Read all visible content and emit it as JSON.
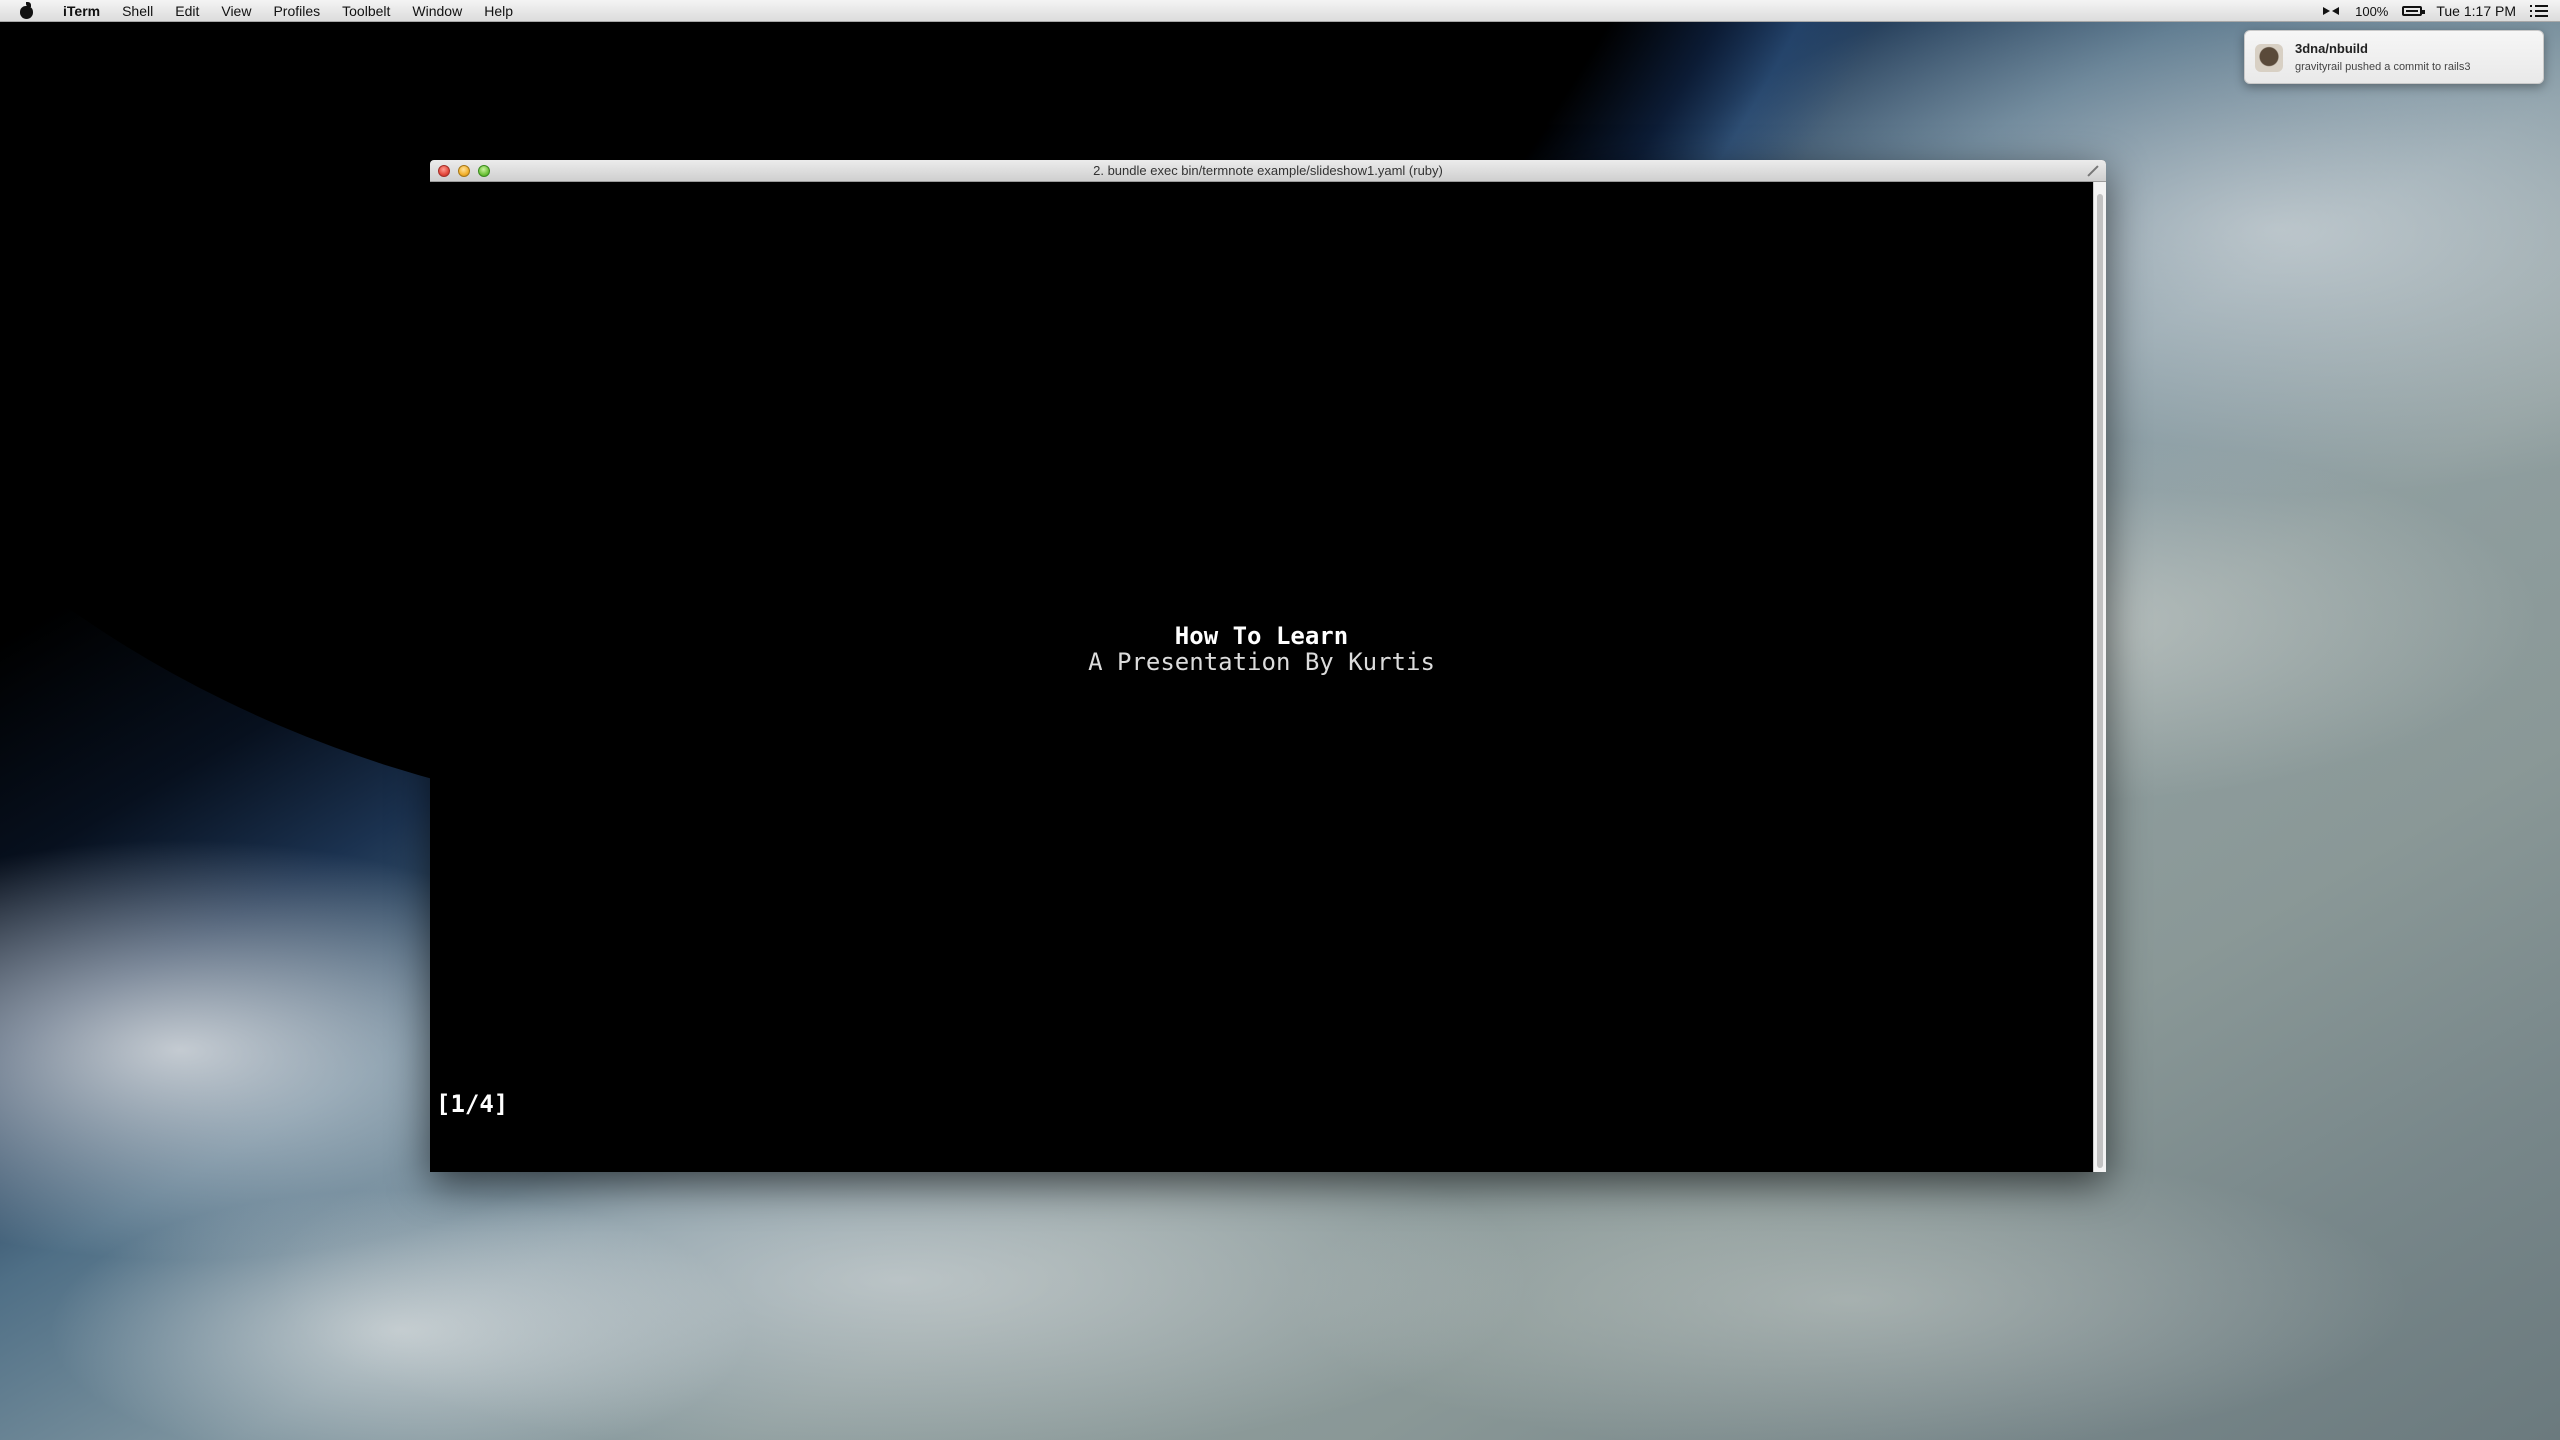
{
  "menubar": {
    "app_name": "iTerm",
    "items": [
      "Shell",
      "Edit",
      "View",
      "Profiles",
      "Toolbelt",
      "Window",
      "Help"
    ],
    "battery_percent": "100%",
    "clock": "Tue 1:17 PM"
  },
  "notification": {
    "title": "3dna/nbuild",
    "body": "gravityrail pushed a commit to rails3"
  },
  "terminal": {
    "window_title": "2. bundle exec bin/termnote example/slideshow1.yaml (ruby)",
    "slide_title": "How To Learn",
    "slide_subtitle": "A Presentation By Kurtis",
    "slide_counter": "[1/4]"
  },
  "icons": {
    "apple": "apple-icon",
    "bluetooth": "bluetooth-icon",
    "battery": "battery-icon",
    "notification_center": "notification-center-icon",
    "github_avatar": "octocat-avatar-icon"
  }
}
